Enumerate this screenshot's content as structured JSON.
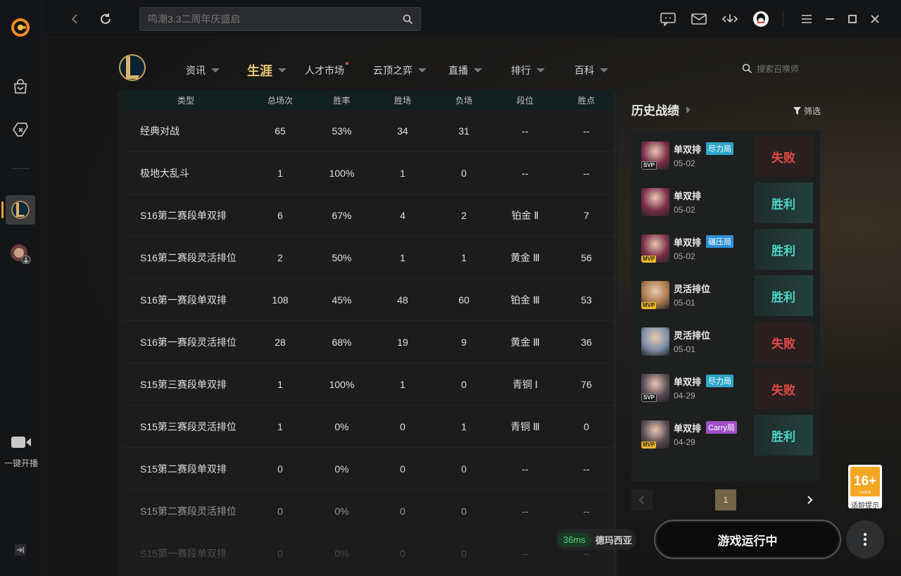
{
  "topbar": {
    "search_placeholder": "鸣潮3.3二周年庆盛启"
  },
  "left_rail": {
    "live_label": "一键开播"
  },
  "game_nav": {
    "items": [
      {
        "label": "资讯",
        "caret": true
      },
      {
        "label": "生涯",
        "caret": true,
        "active": true
      },
      {
        "label": "人才市场",
        "dot": true
      },
      {
        "label": "云顶之弈",
        "caret": true
      },
      {
        "label": "直播",
        "caret": true
      },
      {
        "label": "排行",
        "caret": true
      },
      {
        "label": "百科",
        "caret": true
      }
    ],
    "summoner_search_placeholder": "搜索召唤师"
  },
  "stats_table": {
    "headers": [
      "类型",
      "总场次",
      "胜率",
      "胜场",
      "负场",
      "段位",
      "胜点"
    ],
    "rows": [
      [
        "经典对战",
        "65",
        "53%",
        "34",
        "31",
        "--",
        "--"
      ],
      [
        "极地大乱斗",
        "1",
        "100%",
        "1",
        "0",
        "--",
        "--"
      ],
      [
        "S16第二赛段单双排",
        "6",
        "67%",
        "4",
        "2",
        "铂金 Ⅱ",
        "7"
      ],
      [
        "S16第二赛段灵活排位",
        "2",
        "50%",
        "1",
        "1",
        "黄金 Ⅲ",
        "56"
      ],
      [
        "S16第一赛段单双排",
        "108",
        "45%",
        "48",
        "60",
        "铂金 Ⅲ",
        "53"
      ],
      [
        "S16第一赛段灵活排位",
        "28",
        "68%",
        "19",
        "9",
        "黄金 Ⅲ",
        "36"
      ],
      [
        "S15第三赛段单双排",
        "1",
        "100%",
        "1",
        "0",
        "青铜 Ⅰ",
        "76"
      ],
      [
        "S15第三赛段灵活排位",
        "1",
        "0%",
        "0",
        "1",
        "青铜 Ⅲ",
        "0"
      ],
      [
        "S15第二赛段单双排",
        "0",
        "0%",
        "0",
        "0",
        "--",
        "--"
      ],
      [
        "S15第二赛段灵活排位",
        "0",
        "0%",
        "0",
        "0",
        "--",
        "--"
      ],
      [
        "S15第一赛段单双排",
        "0",
        "0%",
        "0",
        "0",
        "--",
        "--"
      ]
    ]
  },
  "history": {
    "title": "历史战绩",
    "filter_label": "筛选",
    "matches": [
      {
        "mode": "单双排",
        "tag": "尽力局",
        "tag_color": "#2ea6c9",
        "date": "05-02",
        "badge": "SVP",
        "result": "失败",
        "win": false,
        "champ_color": "#7a2d4a"
      },
      {
        "mode": "单双排",
        "tag": "",
        "tag_color": "",
        "date": "05-02",
        "badge": "",
        "result": "胜利",
        "win": true,
        "champ_color": "#7a2d4a"
      },
      {
        "mode": "单双排",
        "tag": "碾压局",
        "tag_color": "#2e8fd8",
        "date": "05-02",
        "badge": "MVP",
        "result": "胜利",
        "win": true,
        "champ_color": "#7a2d4a"
      },
      {
        "mode": "灵活排位",
        "tag": "",
        "tag_color": "",
        "date": "05-01",
        "badge": "MVP",
        "result": "胜利",
        "win": true,
        "champ_color": "#a8784a"
      },
      {
        "mode": "灵活排位",
        "tag": "",
        "tag_color": "",
        "date": "05-01",
        "badge": "",
        "result": "失败",
        "win": false,
        "champ_color": "#7d8fa8"
      },
      {
        "mode": "单双排",
        "tag": "尽力局",
        "tag_color": "#2ea6c9",
        "date": "04-29",
        "badge": "SVP",
        "result": "失败",
        "win": false,
        "champ_color": "#5a4a55"
      },
      {
        "mode": "单双排",
        "tag": "Carry局",
        "tag_color": "#a04fc6",
        "date": "04-29",
        "badge": "MVP",
        "result": "胜利",
        "win": true,
        "champ_color": "#5a4a55"
      }
    ],
    "current_page": "1"
  },
  "status": {
    "ping": "36ms",
    "server": "德玛西亚"
  },
  "launch_button": "游戏运行中",
  "age_rating": {
    "rating": "16+",
    "org": "CADPA",
    "tip": "适龄提示"
  }
}
